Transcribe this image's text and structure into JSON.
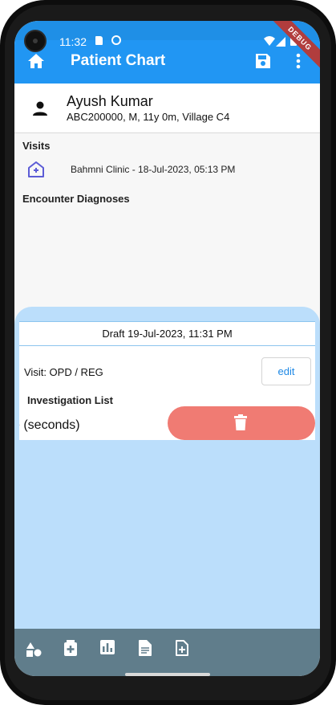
{
  "status_bar": {
    "time": "11:32",
    "debug_label": "DEBUG"
  },
  "app_bar": {
    "title": "Patient Chart",
    "color": "#2196f3"
  },
  "patient": {
    "name": "Ayush Kumar",
    "info": "ABC200000, M, 11y 0m,  Village C4"
  },
  "visits": {
    "title": "Visits",
    "items": [
      {
        "label": "Bahmni Clinic - 18-Jul-2023, 05:13 PM"
      }
    ]
  },
  "encounter_diagnoses": {
    "title": "Encounter Diagnoses"
  },
  "draft": {
    "title": "Draft 19-Jul-2023, 11:31 PM",
    "visit_type": "Visit: OPD / REG",
    "edit_label": "edit",
    "investigation_title": "Investigation List",
    "investigation_item": "e (seconds)",
    "delete_color": "#f07b73"
  },
  "bottom_nav": {
    "items": [
      "shapes-icon",
      "medicine-box-icon",
      "chart-icon",
      "document-icon",
      "add-document-icon"
    ],
    "color": "#607d8b"
  }
}
